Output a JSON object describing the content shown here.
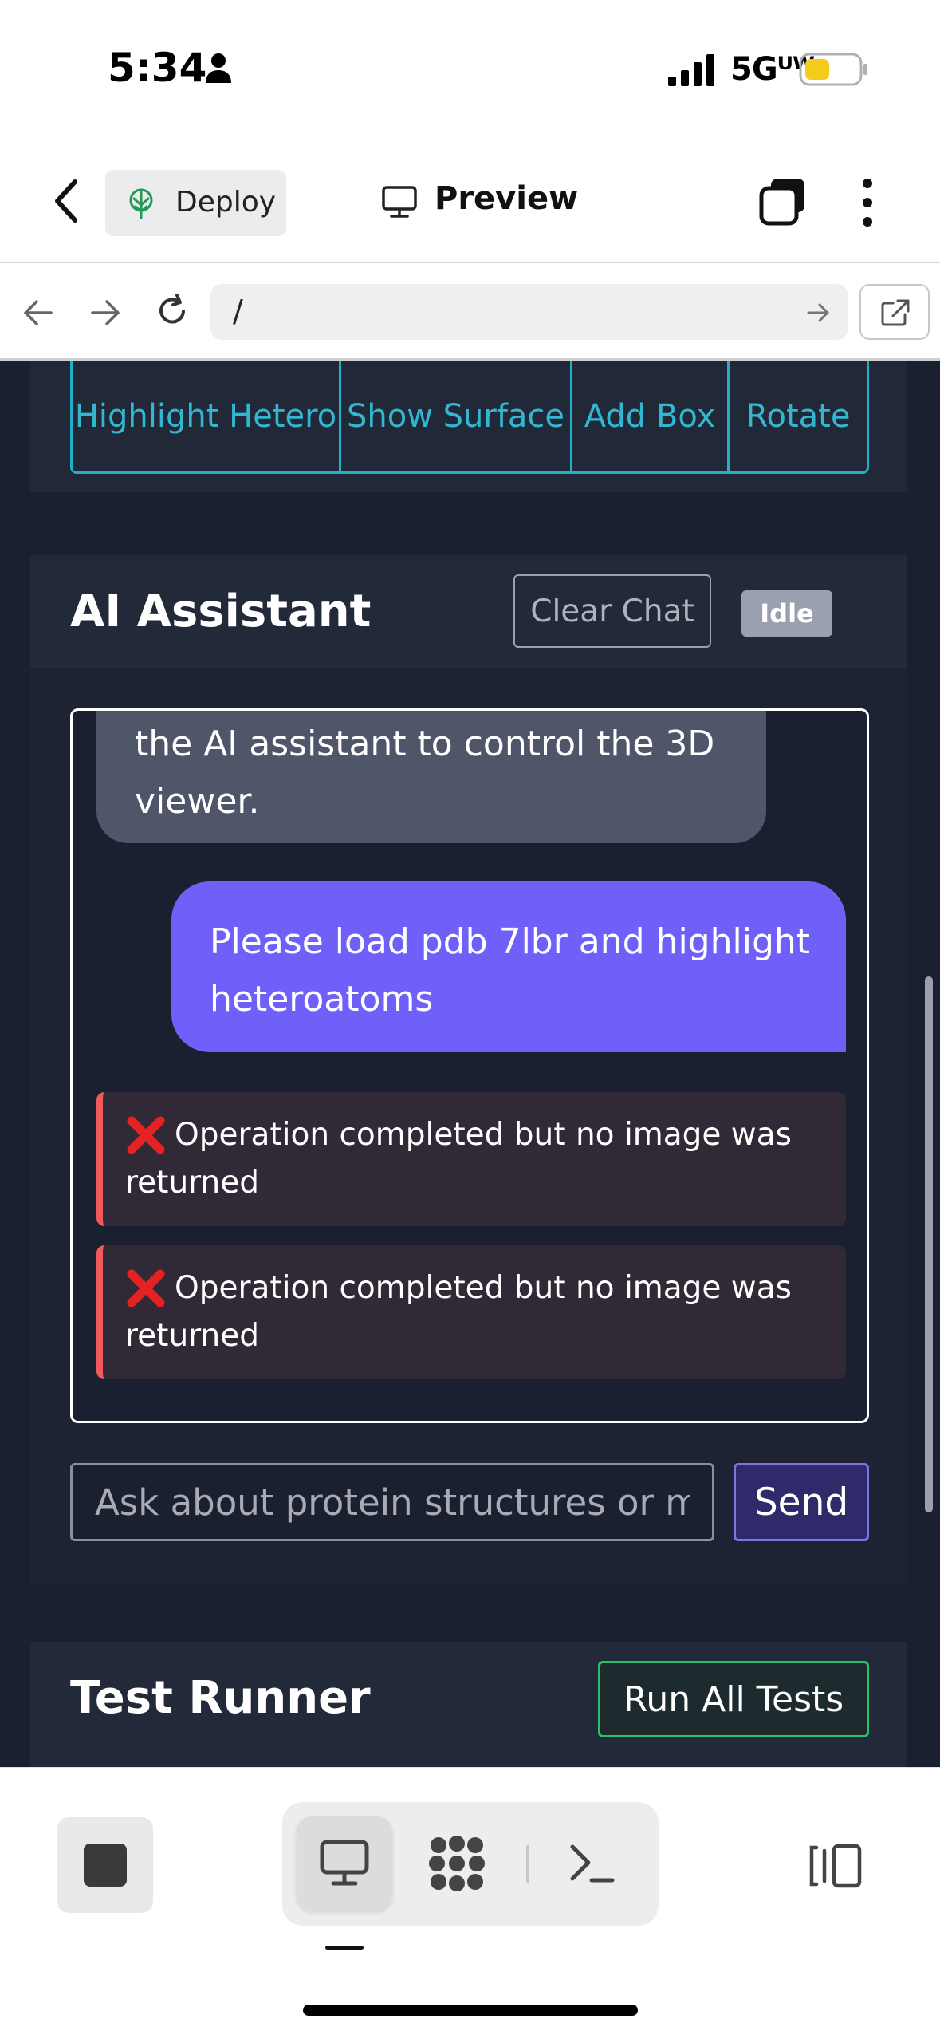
{
  "status_bar": {
    "time": "5:34",
    "network": "5Gᵁᵂ"
  },
  "header": {
    "deploy_label": "Deploy",
    "preview_label": "Preview"
  },
  "browser": {
    "url": "/"
  },
  "viewer_controls": [
    {
      "label": "Highlight Hetero"
    },
    {
      "label": "Show Surface"
    },
    {
      "label": "Add Box"
    },
    {
      "label": "Rotate"
    }
  ],
  "ai_assistant": {
    "title": "AI Assistant",
    "clear_chat_label": "Clear Chat",
    "status_badge": "Idle",
    "messages": {
      "bot_intro": "the AI assistant to control the 3D viewer.",
      "user_request": "Please load pdb 7lbr and highlight heteroatoms",
      "error_1": "Operation completed but no image was returned",
      "error_2": "Operation completed but no image was returned"
    },
    "input_placeholder": "Ask about protein structures or mo",
    "send_label": "Send"
  },
  "test_runner": {
    "title": "Test Runner",
    "run_label": "Run All Tests"
  },
  "colors": {
    "background_dark": "#1b2030",
    "accent_cyan": "#22b0c8",
    "user_bubble": "#7060fa",
    "error_border": "#f05a5a",
    "run_button_border": "#2bc06a"
  }
}
